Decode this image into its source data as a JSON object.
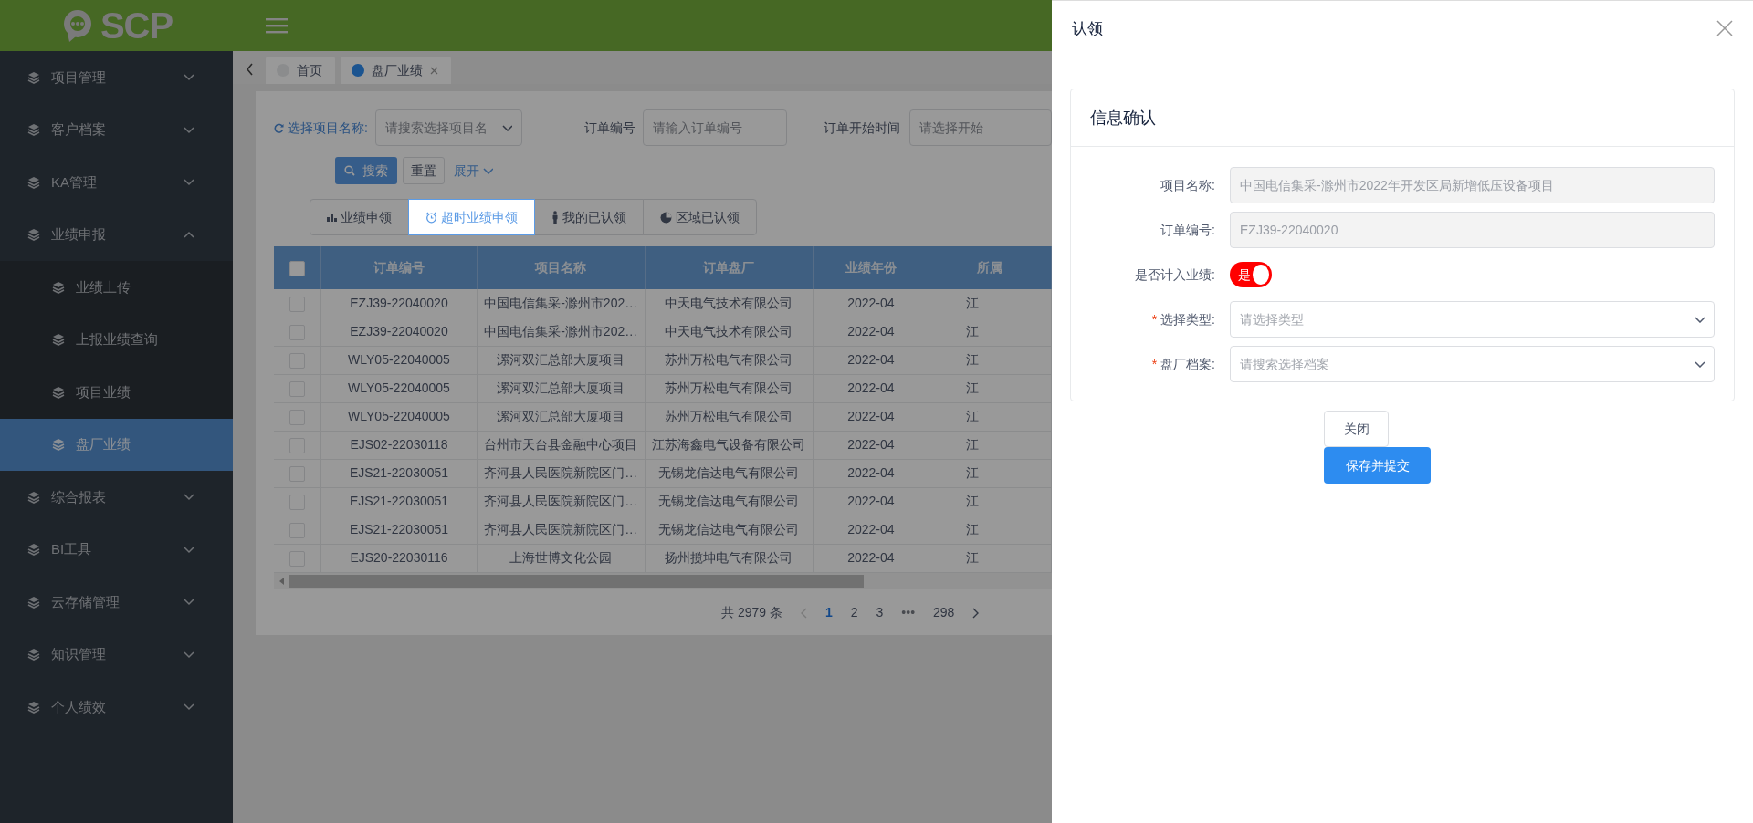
{
  "header": {
    "logo": "SCP"
  },
  "sidebar": {
    "items": [
      {
        "label": "项目管理",
        "expanded": false,
        "selected": false
      },
      {
        "label": "客户档案",
        "expanded": false,
        "selected": false
      },
      {
        "label": "KA管理",
        "expanded": false,
        "selected": false
      },
      {
        "label": "业绩申报",
        "expanded": true,
        "selected": false,
        "children": [
          {
            "label": "业绩上传",
            "selected": false
          },
          {
            "label": "上报业绩查询",
            "selected": false
          },
          {
            "label": "项目业绩",
            "selected": false
          },
          {
            "label": "盘厂业绩",
            "selected": true
          }
        ]
      },
      {
        "label": "综合报表",
        "expanded": false,
        "selected": false
      },
      {
        "label": "BI工具",
        "expanded": false,
        "selected": false
      },
      {
        "label": "云存储管理",
        "expanded": false,
        "selected": false
      },
      {
        "label": "知识管理",
        "expanded": false,
        "selected": false
      },
      {
        "label": "个人绩效",
        "expanded": false,
        "selected": false
      }
    ]
  },
  "page_tabs": [
    {
      "label": "首页",
      "selected": false,
      "closable": false
    },
    {
      "label": "盘厂业绩",
      "selected": true,
      "closable": true
    }
  ],
  "filters": [
    {
      "kind": "select",
      "label": "选择项目名称:",
      "placeholder": "请搜索选择项目名"
    },
    {
      "kind": "input",
      "label": "订单编号",
      "placeholder": "请输入订单编号"
    },
    {
      "kind": "input",
      "label": "订单开始时间",
      "placeholder": "请选择开始"
    }
  ],
  "actions": {
    "search": "搜索",
    "reset": "重置",
    "expand": "展开"
  },
  "view_tabs": [
    {
      "label": "业绩申领",
      "selected": false
    },
    {
      "label": "超时业绩申领",
      "selected": true
    },
    {
      "label": "我的已认领",
      "selected": false
    },
    {
      "label": "区域已认领",
      "selected": false
    }
  ],
  "table": {
    "all_selected": false,
    "columns": [
      "订单编号",
      "项目名称",
      "订单盘厂",
      "业绩年份",
      "所属"
    ],
    "rows": [
      {
        "selected": false,
        "cells": [
          "EZJ39-22040020",
          "中国电信集采-滁州市202…",
          "中天电气技术有限公司",
          "2022-04",
          "江"
        ]
      },
      {
        "selected": false,
        "cells": [
          "EZJ39-22040020",
          "中国电信集采-滁州市202…",
          "中天电气技术有限公司",
          "2022-04",
          "江"
        ]
      },
      {
        "selected": false,
        "cells": [
          "WLY05-22040005",
          "漯河双汇总部大厦项目",
          "苏州万松电气有限公司",
          "2022-04",
          "江"
        ]
      },
      {
        "selected": false,
        "cells": [
          "WLY05-22040005",
          "漯河双汇总部大厦项目",
          "苏州万松电气有限公司",
          "2022-04",
          "江"
        ]
      },
      {
        "selected": false,
        "cells": [
          "WLY05-22040005",
          "漯河双汇总部大厦项目",
          "苏州万松电气有限公司",
          "2022-04",
          "江"
        ]
      },
      {
        "selected": false,
        "cells": [
          "EJS02-22030118",
          "台州市天台县金融中心项目",
          "江苏海鑫电气设备有限公司",
          "2022-04",
          "江"
        ]
      },
      {
        "selected": false,
        "cells": [
          "EJS21-22030051",
          "齐河县人民医院新院区门…",
          "无锡龙信达电气有限公司",
          "2022-04",
          "江"
        ]
      },
      {
        "selected": false,
        "cells": [
          "EJS21-22030051",
          "齐河县人民医院新院区门…",
          "无锡龙信达电气有限公司",
          "2022-04",
          "江"
        ]
      },
      {
        "selected": false,
        "cells": [
          "EJS21-22030051",
          "齐河县人民医院新院区门…",
          "无锡龙信达电气有限公司",
          "2022-04",
          "江"
        ]
      },
      {
        "selected": false,
        "cells": [
          "EJS20-22030116",
          "上海世博文化公园",
          "扬州揽坤电气有限公司",
          "2022-04",
          "江"
        ]
      }
    ]
  },
  "pagination": {
    "total": "共 2979 条",
    "pages": [
      {
        "kind": "page",
        "label": "1",
        "selected": true
      },
      {
        "kind": "page",
        "label": "2",
        "selected": false
      },
      {
        "kind": "page",
        "label": "3",
        "selected": false
      },
      {
        "kind": "ellipsis",
        "label": "•••"
      },
      {
        "kind": "page",
        "label": "298",
        "selected": false
      }
    ]
  },
  "drawer": {
    "title": "认领",
    "section_title": "信息确认",
    "fields": [
      {
        "kind": "text",
        "label": "项目名称:",
        "disabled": true,
        "value": "中国电信集采-滁州市2022年开发区局新增低压设备项目"
      },
      {
        "kind": "text",
        "label": "订单编号:",
        "disabled": true,
        "value": "EZJ39-22040020"
      },
      {
        "kind": "switch",
        "label": "是否计入业绩:",
        "on": true,
        "text": "是"
      },
      {
        "kind": "select",
        "label": "选择类型:",
        "required_mark": "*",
        "placeholder": "请选择类型"
      },
      {
        "kind": "select",
        "label": "盘厂档案:",
        "required_mark": "*",
        "placeholder": "请搜索选择档案"
      }
    ],
    "buttons": [
      {
        "kind": "default",
        "label": "关闭"
      },
      {
        "kind": "primary",
        "label": "保存并提交"
      }
    ]
  }
}
